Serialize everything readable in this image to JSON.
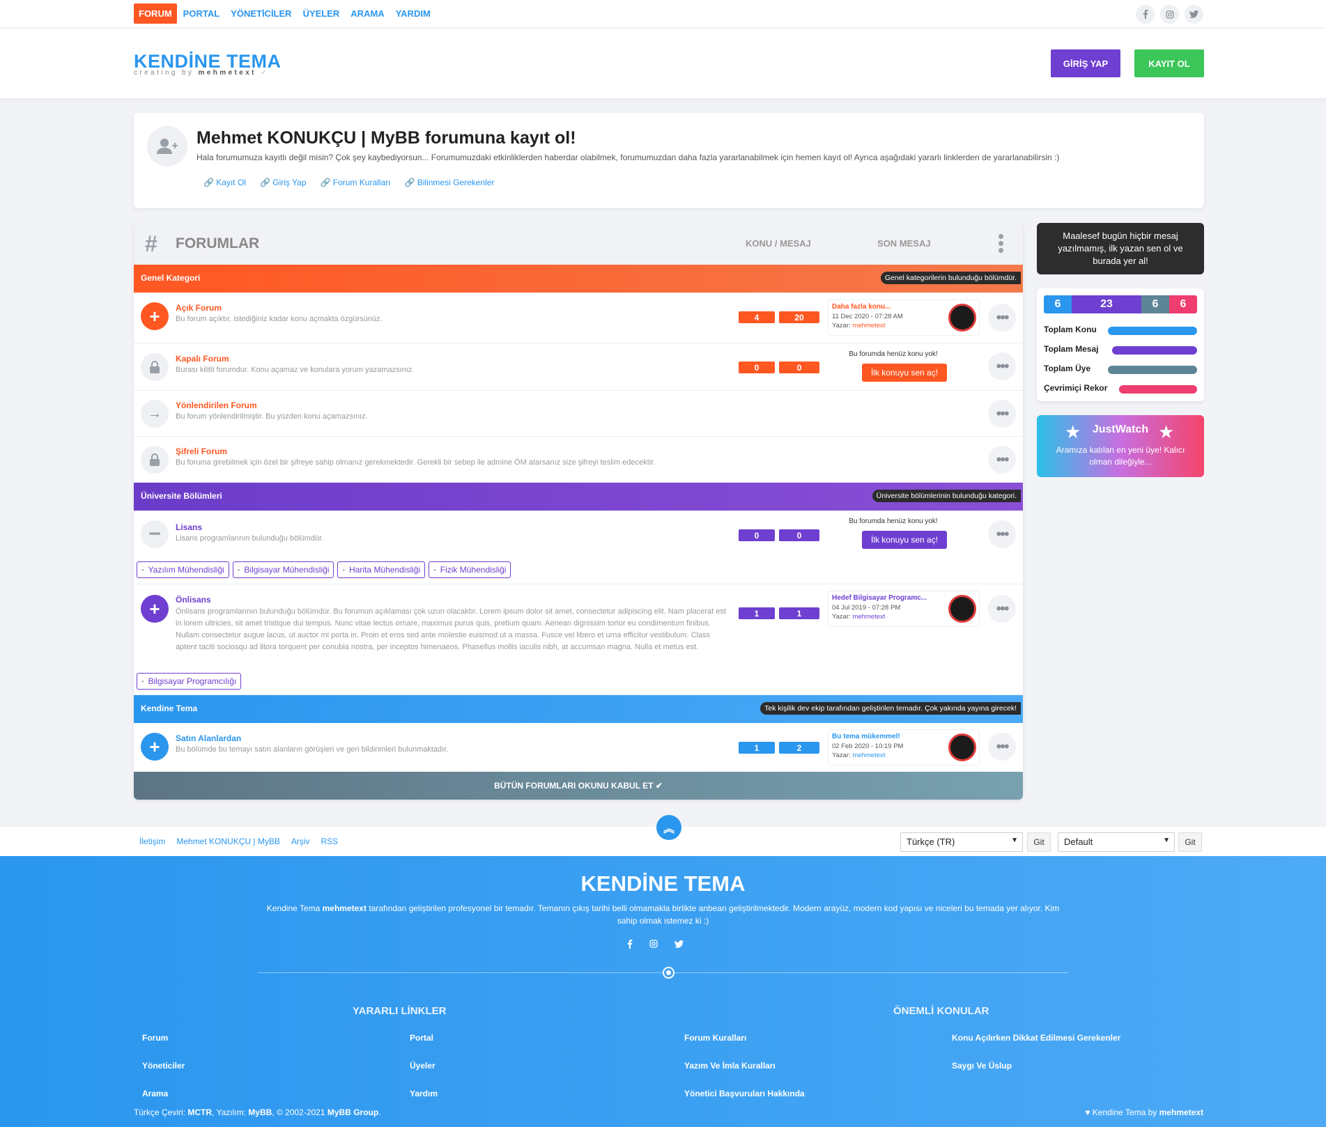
{
  "topnav": [
    "FORUM",
    "PORTAL",
    "YÖNETİCİLER",
    "ÜYELER",
    "ARAMA",
    "YARDIM"
  ],
  "social_icons": [
    "facebook-icon",
    "instagram-icon",
    "twitter-icon"
  ],
  "header": {
    "logo_title": "KENDİNE TEMA",
    "logo_sub_prefix": "creating by",
    "logo_sub_author": "mehmetext",
    "login_label": "GİRİŞ YAP",
    "register_label": "KAYIT OL"
  },
  "welcome": {
    "title": "Mehmet KONUKÇU | MyBB forumuna kayıt ol!",
    "desc": "Hala forumumuza kayıtlı değil misin? Çok şey kaybediyorsun... Forumumuzdaki etkinliklerden haberdar olabilmek, forumumuzdan daha fazla yararlanabilmek için hemen kayıt ol! Ayrıca aşağıdaki yararlı linklerden de yararlanabilirsin :)",
    "links": [
      "Kayıt Ol",
      "Giriş Yap",
      "Forum Kuralları",
      "Bilinmesi Gerekenler"
    ]
  },
  "forums": {
    "title": "FORUMLAR",
    "col_stats": "KONU / MESAJ",
    "col_last": "SON MESAJ",
    "categories": [
      {
        "name": "Genel Kategori",
        "desc": "Genel kategorilerin bulunduğu bölümdür."
      },
      {
        "name": "Üniversite Bölümleri",
        "desc": "Üniversite bölümlerinin bulunduğu kategori."
      },
      {
        "name": "Kendine Tema",
        "desc": "Tek kişilik dev ekip tarafından geliştirilen temadır. Çok yakında yayına girecek!"
      }
    ],
    "rows": [
      {
        "name": "Açık Forum",
        "desc": "Bu forum açıktır, istediğiniz kadar konu açmakta özgürsünüz.",
        "topics": "4",
        "posts": "20",
        "last_title": "Daha fazla konu...",
        "last_date": "11 Dec 2020 - 07:28 AM",
        "last_by": "Yazar:",
        "last_user": "mehmetext"
      },
      {
        "name": "Kapalı Forum",
        "desc": "Burası kilitli forumdur. Konu açamaz ve konulara yorum yazamazsınız.",
        "topics": "0",
        "posts": "0",
        "nothing": "Bu forumda henüz konu yok!",
        "new_btn": "İlk konuyu sen aç!"
      },
      {
        "name": "Yönlendirilen Forum",
        "desc": "Bu forum yönlendirilmiştir. Bu yüzden konu açamazsınız."
      },
      {
        "name": "Şifreli Forum",
        "desc": "Bu foruma girebilmek için özel bir şifreye sahip olmanız gerekmektedir. Gerekli bir sebep ile admine ÖM atarsanız size şifreyi teslim edecektir."
      },
      {
        "name": "Lisans",
        "desc": "Lisans programlarının bulunduğu bölümdür.",
        "topics": "0",
        "posts": "0",
        "nothing": "Bu forumda henüz konu yok!",
        "new_btn": "İlk konuyu sen aç!",
        "subforums": [
          "Yazılım Mühendisliği",
          "Bilgisayar Mühendisliği",
          "Harita Mühendisliği",
          "Fizik Mühendisliği"
        ]
      },
      {
        "name": "Önlisans",
        "desc": "Önlisans programlarının bulunduğu bölümdür. Bu forumun açıklaması çok uzun olacaktır. Lorem ipsum dolor sit amet, consectetur adipiscing elit. Nam placerat est in lorem ultricies, sit amet tristique dui tempus. Nunc vitae lectus ornare, maximus purus quis, pretium quam. Aenean dignissim tortor eu condimentum finibus. Nullam consectetur augue lacus, ut auctor mi porta in. Proin et eros sed ante molestie euismod ut a massa. Fusce vel libero et urna efficitur vestibulum. Class aptent taciti sociosqu ad litora torquent per conubia nostra, per inceptos himenaeos. Phasellus mollis iaculis nibh, at accumsan magna. Nulla et metus est.",
        "topics": "1",
        "posts": "1",
        "last_title": "Hedef Bilgisayar Programc...",
        "last_date": "04 Jul 2019 - 07:28 PM",
        "last_by": "Yazar:",
        "last_user": "mehmetext",
        "subforums": [
          "Bilgisayar Programcılığı"
        ]
      },
      {
        "name": "Satın Alanlardan",
        "desc": "Bu bölümde bu temayı satın alanların görüşleri ve geri bildirimleri bulunmaktadır.",
        "topics": "1",
        "posts": "2",
        "last_title": "Bu tema mükemmel!",
        "last_date": "02 Feb 2020 - 10:19 PM",
        "last_by": "Yazar:",
        "last_user": "mehmetext"
      }
    ],
    "mark_read": "BÜTÜN FORUMLARI OKUNU KABUL ET ✔"
  },
  "sidebar": {
    "notice": "Maalesef bugün hiçbir mesaj yazılmamış, ilk yazan sen ol ve burada yer al!",
    "stats_bar": [
      "6",
      "23",
      "6",
      "6"
    ],
    "stats": [
      {
        "label": "Toplam Konu",
        "color": "#2a96ee"
      },
      {
        "label": "Toplam Mesaj",
        "color": "#6e3fd0"
      },
      {
        "label": "Toplam Üye",
        "color": "#5d8596"
      },
      {
        "label": "Çevrimiçi Rekor",
        "color": "#ee3d6e"
      }
    ],
    "newest_title": "JustWatch",
    "newest_desc": "Aramıza katılan en yeni üye! Kalıcı olman dileğiyle..."
  },
  "footbar": {
    "links": [
      "İletişim",
      "Mehmet KONUKÇU | MyBB",
      "Arşiv",
      "RSS"
    ],
    "language": "Türkçe (TR)",
    "theme": "Default",
    "go": "Git"
  },
  "footer": {
    "title": "KENDİNE TEMA",
    "desc_pre": "Kendine Tema",
    "desc_author": "mehmetext",
    "desc_post": "tarafından geliştirilen profesyonel bir temadır. Temanın çıkış tarihi belli olmamakla birlikte anbean geliştirilmektedir. Modern arayüz, modern kod yapısı ve niceleri bu temada yer alıyor. Kim sahip olmak istemez ki :)",
    "useful_title": "YARARLI LİNKLER",
    "useful": [
      "Forum",
      "Portal",
      "Yöneticiler",
      "Üyeler",
      "Arama",
      "Yardım"
    ],
    "important_title": "ÖNEMLİ KONULAR",
    "important": [
      "Forum Kuralları",
      "Konu Açılırken Dikkat Edilmesi Gerekenler",
      "Yazım Ve İmla Kuralları",
      "Saygı Ve Üslup",
      "Yönetici Başvuruları Hakkında"
    ],
    "copy_1": "Türkçe Çeviri:",
    "copy_mctr": "MCTR",
    "copy_2": ", Yazılım:",
    "copy_mybb": "MyBB",
    "copy_3": ", © 2002-2021",
    "copy_group": "MyBB Group",
    "copy_4": ".",
    "credit_pre": "Kendine Tema by",
    "credit_author": "mehmetext"
  }
}
